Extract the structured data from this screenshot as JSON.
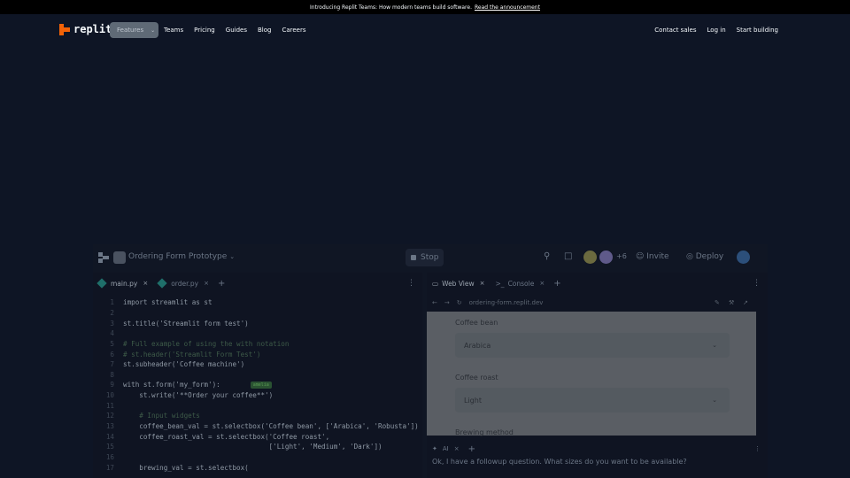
{
  "announcement": {
    "text": "Introducing Replit Teams: How modern teams build software.",
    "link": "Read the announcement"
  },
  "nav": {
    "brand": "replit",
    "links": [
      "Features",
      "Teams",
      "Pricing",
      "Guides",
      "Blog",
      "Careers"
    ],
    "right": [
      "Contact sales",
      "Log in",
      "Start building"
    ]
  },
  "ide": {
    "project_name": "Ordering Form Prototype",
    "stop_label": "Stop",
    "collab_count": "+6",
    "invite_label": "Invite",
    "deploy_label": "Deploy",
    "editor_tabs": [
      "main.py",
      "order.py"
    ],
    "code_lines": [
      {
        "n": "1",
        "t": "import streamlit as st"
      },
      {
        "n": "2",
        "t": ""
      },
      {
        "n": "3",
        "t": "st.title('Streamlit form test')"
      },
      {
        "n": "4",
        "t": ""
      },
      {
        "n": "5",
        "t": "# Full example of using the with notation"
      },
      {
        "n": "6",
        "t": "# st.header('Streamlit Form Test')"
      },
      {
        "n": "7",
        "t": "st.subheader('Coffee machine')"
      },
      {
        "n": "8",
        "t": ""
      },
      {
        "n": "9",
        "t": "with st.form('my_form'):"
      },
      {
        "n": "10",
        "t": "    st.write('**Order your coffee**')"
      },
      {
        "n": "11",
        "t": ""
      },
      {
        "n": "12",
        "t": "    # Input widgets"
      },
      {
        "n": "13",
        "t": "    coffee_bean_val = st.selectbox('Coffee bean', ['Arabica', 'Robusta'])"
      },
      {
        "n": "14",
        "t": "    coffee_roast_val = st.selectbox('Coffee roast',"
      },
      {
        "n": "15",
        "t": "                                    ['Light', 'Medium', 'Dark'])"
      },
      {
        "n": "16",
        "t": ""
      },
      {
        "n": "17",
        "t": "    brewing_val = st.selectbox("
      }
    ],
    "inline_badge": "amelia",
    "right_tabs": [
      "Web View",
      "Console"
    ],
    "url": "ordering-form.replit.dev",
    "webview": {
      "fields": [
        {
          "label": "Coffee bean",
          "value": "Arabica"
        },
        {
          "label": "Coffee roast",
          "value": "Light"
        }
      ],
      "next_label": "Brewing method"
    },
    "ai_tab": "AI",
    "ai_message": "Ok, I have a followup question. What sizes do you want to be available?"
  },
  "colors": {
    "background": "#0e1525",
    "brand_orange": "#f26207"
  }
}
